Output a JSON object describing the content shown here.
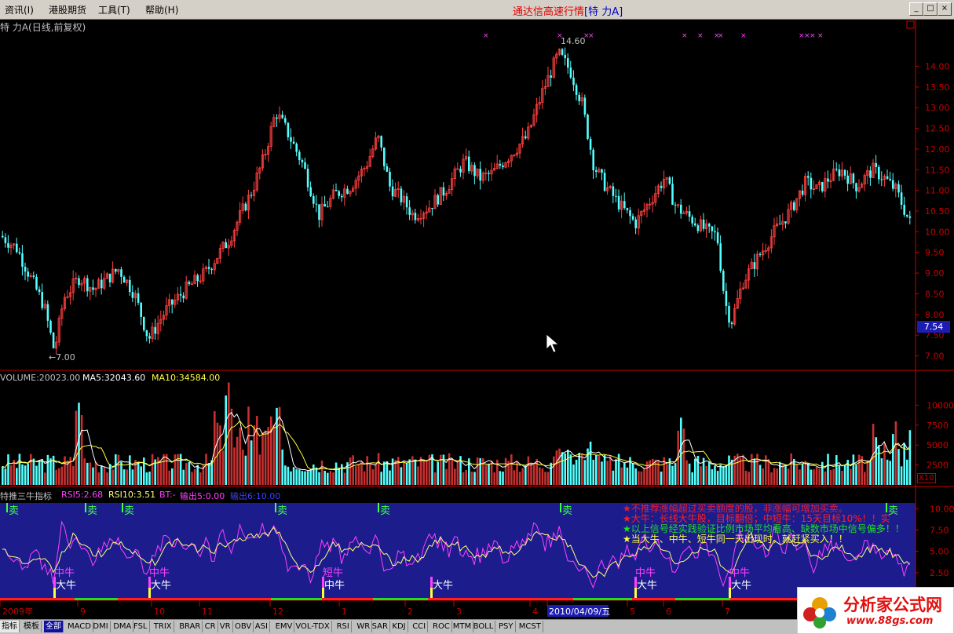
{
  "menu": {
    "items": [
      "资讯(I)",
      "港股期货",
      "工具(T)",
      "帮助(H)"
    ]
  },
  "app_title": {
    "text": "通达信高速行情",
    "open": "[",
    "stock": "特  力A",
    "close": "]"
  },
  "window_buttons": {
    "minimize": "_",
    "maximize": "□",
    "close": "×"
  },
  "price_panel": {
    "title": "特  力A(日线,前复权)",
    "high_label": "14.60",
    "low_label": "←7.00",
    "current_price": "7.54",
    "y_ticks": [
      "14.00",
      "13.50",
      "13.00",
      "12.50",
      "12.00",
      "11.50",
      "11.00",
      "10.50",
      "10.00",
      "9.50",
      "9.00",
      "8.50",
      "8.00",
      "7.50",
      "7.00"
    ]
  },
  "volume_panel": {
    "volume": "VOLUME:20023.00",
    "ma5": "MA5:32043.60",
    "ma10": "MA10:34584.00",
    "y_ticks": [
      "10000",
      "7500",
      "5000",
      "2500"
    ],
    "unit": "X10"
  },
  "indicator_panel": {
    "name": "特推三牛指标",
    "rsi5": "RSI5:2.68",
    "rsi10": "RSI10:3.51",
    "bt": "BT:-",
    "out5": "输出5:0.00",
    "out6": "输出6:10.00",
    "y_ticks": [
      "10.00",
      "7.50",
      "5.00",
      "2.50"
    ],
    "notes": [
      "★不推荐涨幅超过买卖额度的股，非涨幅可增加买卖。",
      "★大牛：长线大牛股，目标翻倍；中短牛：15天目标10%！！实",
      "★以上信号经实践验证比例市场平均看高、缺数市场中信号偏多！！",
      "★当大牛、中牛、短牛同一天出现时，就赶紧买入！！"
    ],
    "signals": [
      {
        "label": "卖",
        "kind": "sell"
      },
      {
        "label": "卖",
        "kind": "sell"
      },
      {
        "label": "卖",
        "kind": "sell"
      },
      {
        "label": "卖",
        "kind": "sell"
      },
      {
        "label": "卖",
        "kind": "sell"
      },
      {
        "label": "卖",
        "kind": "sell"
      },
      {
        "label": "卖",
        "kind": "sell"
      },
      {
        "label": "中牛",
        "kind": "mid"
      },
      {
        "label": "大牛",
        "kind": "big"
      },
      {
        "label": "中牛",
        "kind": "mid"
      },
      {
        "label": "大牛",
        "kind": "big"
      },
      {
        "label": "短牛",
        "kind": "short"
      },
      {
        "label": "中牛",
        "kind": "mid"
      },
      {
        "label": "大牛",
        "kind": "big"
      },
      {
        "label": "中牛",
        "kind": "mid"
      },
      {
        "label": "大牛",
        "kind": "big"
      },
      {
        "label": "中牛",
        "kind": "mid"
      },
      {
        "label": "大牛",
        "kind": "big"
      }
    ]
  },
  "time_axis": {
    "labels": [
      "2009年",
      "9",
      "10",
      "11",
      "12",
      "1",
      "2",
      "3",
      "4",
      "2010/04/09/五",
      "5",
      "6",
      "7"
    ]
  },
  "bottom_tabs": [
    "指标",
    "模板",
    "全部",
    "MACD",
    "DMI",
    "DMA",
    "FSL",
    "TRIX",
    "BRAR",
    "CR",
    "VR",
    "OBV",
    "ASI",
    "EMV",
    "VOL-TDX",
    "RSI",
    "WR",
    "SAR",
    "KDJ",
    "CCI",
    "ROC",
    "MTM",
    "BOLL",
    "PSY",
    "MCST"
  ],
  "logo": {
    "name": "分析家公式网",
    "url": "www.88gs.com"
  },
  "colors": {
    "up": "#ff4040",
    "down": "#54ffff",
    "axis": "#c80000",
    "rsi5": "#ff40ff",
    "rsi10": "#ffff80",
    "ind_bg": "#1c1c8c",
    "menu_bg": "#d4d0c8"
  }
}
